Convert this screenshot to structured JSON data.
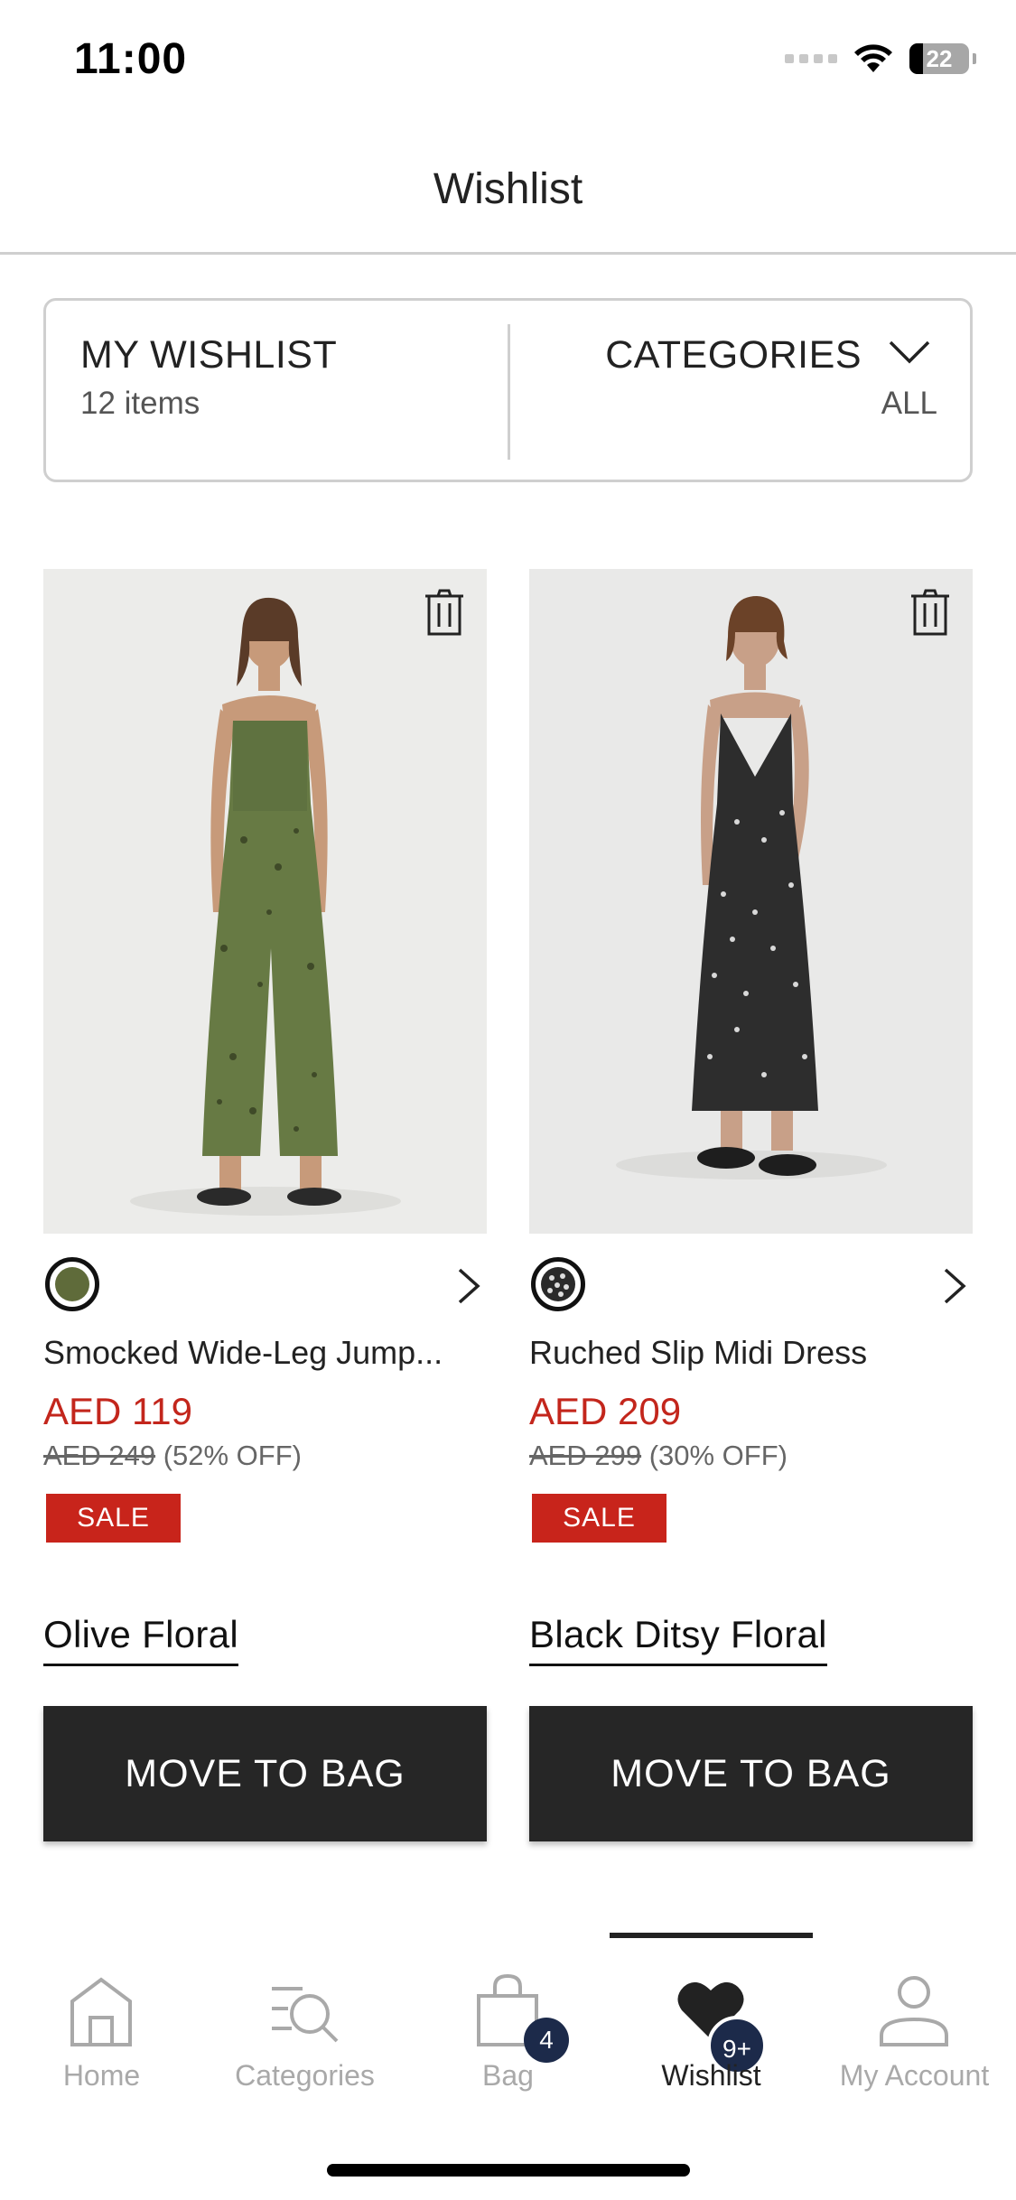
{
  "status_bar": {
    "time": "11:00",
    "battery": "22"
  },
  "header": {
    "title": "Wishlist"
  },
  "summary": {
    "title": "MY WISHLIST",
    "count": "12 items",
    "categories_label": "CATEGORIES",
    "categories_value": "ALL"
  },
  "products": [
    {
      "name": "Smocked Wide-Leg Jump...",
      "price": "AED 119",
      "old_price": "AED 249",
      "discount": "(52% OFF)",
      "badge": "SALE",
      "color": "Olive Floral",
      "swatch_color": "#5f6b3a",
      "button": "MOVE TO BAG"
    },
    {
      "name": "Ruched Slip Midi Dress",
      "price": "AED 209",
      "old_price": "AED 299",
      "discount": "(30% OFF)",
      "badge": "SALE",
      "color": "Black Ditsy Floral",
      "swatch_color": "#2a2a2a",
      "button": "MOVE TO BAG"
    }
  ],
  "tabbar": {
    "items": [
      {
        "label": "Home",
        "icon": "home-icon"
      },
      {
        "label": "Categories",
        "icon": "categories-search-icon"
      },
      {
        "label": "Bag",
        "icon": "bag-icon",
        "badge": "4"
      },
      {
        "label": "Wishlist",
        "icon": "heart-icon",
        "badge": "9+",
        "active": true
      },
      {
        "label": "My Account",
        "icon": "account-icon"
      }
    ]
  },
  "colors": {
    "sale": "#c8241b",
    "price": "#c3261c",
    "button": "#262626",
    "badge": "#1c2a4a"
  }
}
